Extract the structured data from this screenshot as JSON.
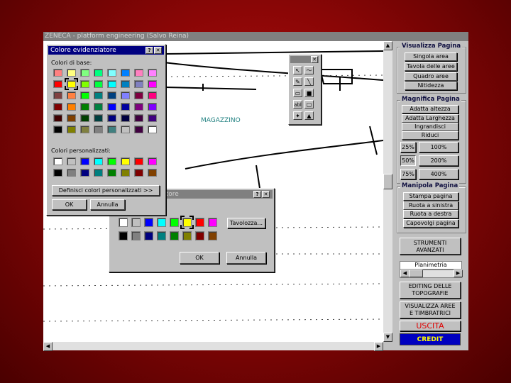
{
  "window": {
    "title": "ZENECA - platform engineering (Salvo Reina)"
  },
  "canvas": {
    "label": "MAGAZZINO"
  },
  "palette_big": {
    "title": "Colore evidenziatore",
    "base_label": "Colori di base:",
    "custom_label": "Colori personalizzati:",
    "define_button": "Definisci colori personalizzati >>",
    "ok": "OK",
    "cancel": "Annulla",
    "base_colors": [
      "#ff8080",
      "#ffff80",
      "#80ff80",
      "#00ff80",
      "#80ffff",
      "#0080ff",
      "#ff80c0",
      "#ff80ff",
      "#ff0000",
      "#ffff00",
      "#80ff00",
      "#00ff40",
      "#00ffff",
      "#0080c0",
      "#8080c0",
      "#ff00ff",
      "#804040",
      "#ff8040",
      "#00ff00",
      "#008080",
      "#004080",
      "#8080ff",
      "#800040",
      "#ff0080",
      "#800000",
      "#ff8000",
      "#008000",
      "#008040",
      "#0000ff",
      "#0000a0",
      "#800080",
      "#8000ff",
      "#400000",
      "#804000",
      "#004000",
      "#004040",
      "#000080",
      "#000040",
      "#400040",
      "#400080",
      "#000000",
      "#808000",
      "#808040",
      "#808080",
      "#408080",
      "#c0c0c0",
      "#400040",
      "#ffffff"
    ],
    "custom_colors": [
      "#ffffff",
      "#c0c0c0",
      "#0000ff",
      "#00ffff",
      "#00ff00",
      "#ffff00",
      "#ff0000",
      "#ff00ff",
      "#000000",
      "#808080",
      "#000080",
      "#008080",
      "#008000",
      "#808000",
      "#800000",
      "#804000"
    ]
  },
  "palette_small": {
    "title": "Colore evidenziatore",
    "colors": [
      "#ffffff",
      "#c0c0c0",
      "#0000ff",
      "#00ffff",
      "#00ff00",
      "#ffff00",
      "#ff0000",
      "#ff00ff",
      "#000000",
      "#808080",
      "#000080",
      "#008080",
      "#008000",
      "#808000",
      "#800000",
      "#804000"
    ],
    "selected_index": 5,
    "more_button": "Tavolozza...",
    "ok": "OK",
    "cancel": "Annulla"
  },
  "toolbox": {
    "tools": [
      "↖",
      "〜",
      "✎",
      "╲",
      "▭",
      "■",
      "abl",
      "▢",
      "✦",
      "▲"
    ]
  },
  "sidebar": {
    "view_group": {
      "title": "Visualizza Pagina",
      "buttons": [
        "Singola area",
        "Tavola delle aree",
        "Quadro aree",
        "Nitidezza"
      ]
    },
    "zoom_group": {
      "title": "Magnifica Pagina",
      "buttons": [
        "Adatta altezza",
        "Adatta Larghezza",
        "Ingrandisci",
        "Riduci"
      ],
      "percent_buttons": [
        "25%",
        "100%",
        "50%",
        "200%",
        "75%",
        "400%"
      ]
    },
    "page_group": {
      "title": "Manipola Pagina",
      "buttons": [
        "Stampa pagina",
        "Ruota a sinistra",
        "Ruota a destra",
        "Capovolgi pagina"
      ]
    },
    "tools_button": "STRUMENTI AVANZATI",
    "select_label": "Planimetria",
    "editing_button": "EDITING DELLE TOPOGRAFIE",
    "view_areas_button": "VISUALIZZA AREE E TIMBRATRICI",
    "exit_button": "USCITA",
    "credit_button": "CREDIT"
  }
}
